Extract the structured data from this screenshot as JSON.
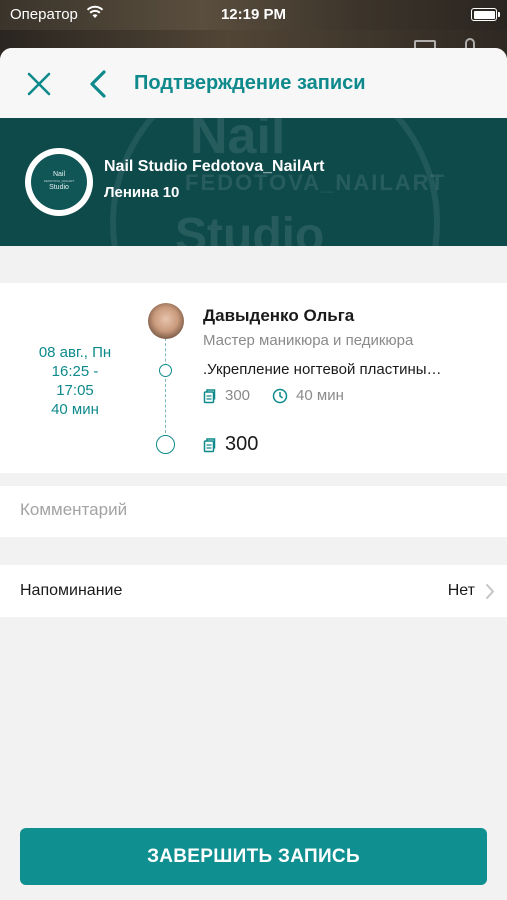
{
  "status_bar": {
    "carrier": "Оператор",
    "time": "12:19 PM"
  },
  "nav": {
    "title": "Подтверждение записи"
  },
  "studio": {
    "logo_text_line1": "Nail",
    "logo_text_small": "FEDOTOVA_NAILART",
    "logo_text_line2": "Studio",
    "name": "Nail Studio Fedotova_NailArt",
    "address": "Ленина 10"
  },
  "appointment": {
    "date": "08 авг., Пн",
    "time_start": "16:25 -",
    "time_end": "17:05",
    "duration": "40 мин",
    "master_name": "Давыденко Ольга",
    "master_role": "Мастер маникюра и педикюра",
    "service_name": ".Укрепление ногтевой пластины гелем",
    "service_price": "300",
    "service_duration": "40 мин",
    "total": "300"
  },
  "comment": {
    "value": "",
    "placeholder": "Комментарий"
  },
  "reminder": {
    "label": "Напоминание",
    "value": "Нет"
  },
  "actions": {
    "complete_label": "ЗАВЕРШИТЬ ЗАПИСЬ"
  },
  "colors": {
    "accent": "#0f8a8c",
    "banner": "#0f4a4b",
    "button": "#0f8f90"
  }
}
